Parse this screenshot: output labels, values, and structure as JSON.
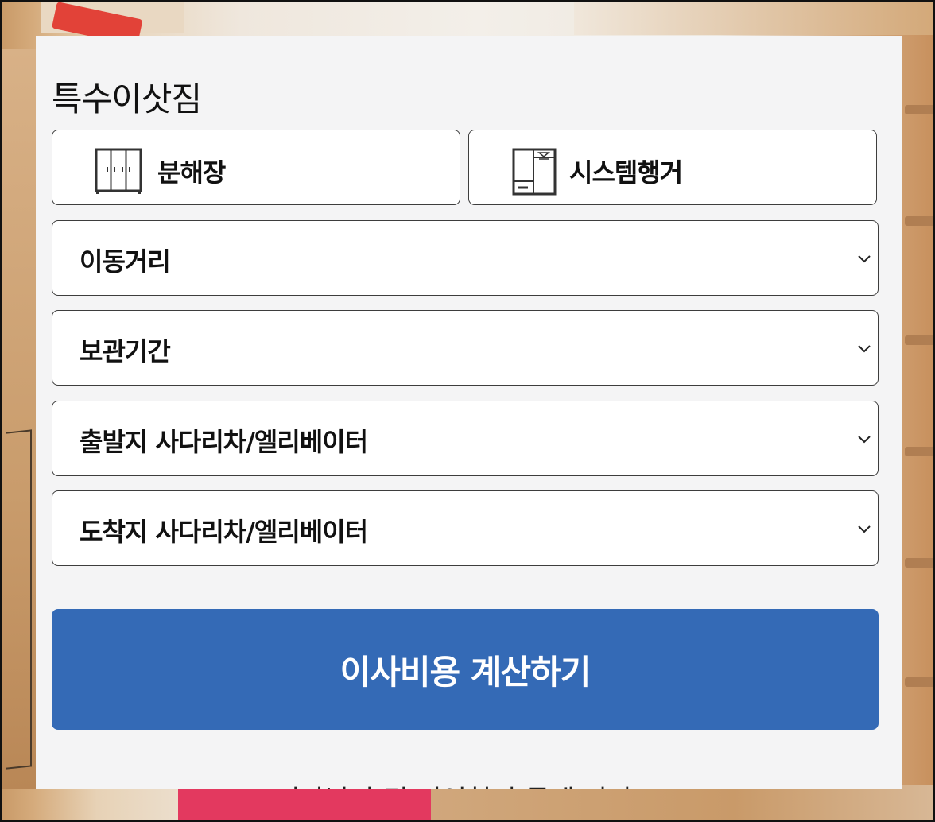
{
  "card": {
    "title": "특수이삿짐",
    "items": [
      {
        "label": "분해장",
        "icon": "wardrobe-icon"
      },
      {
        "label": "시스템행거",
        "icon": "system-hanger-icon"
      }
    ],
    "selects": [
      {
        "label": "이동거리"
      },
      {
        "label": "보관기간"
      },
      {
        "label": "출발지 사다리차/엘리베이터"
      },
      {
        "label": "도착지 사다리차/엘리베이터"
      }
    ],
    "cta_label": "이사비용 계산하기",
    "note_partial": "※ 이사날짜 및 지역현경 등에 따라"
  },
  "colors": {
    "cta": "#346ab6",
    "card_bg": "#f4f4f5",
    "border": "#3d3d3d"
  }
}
